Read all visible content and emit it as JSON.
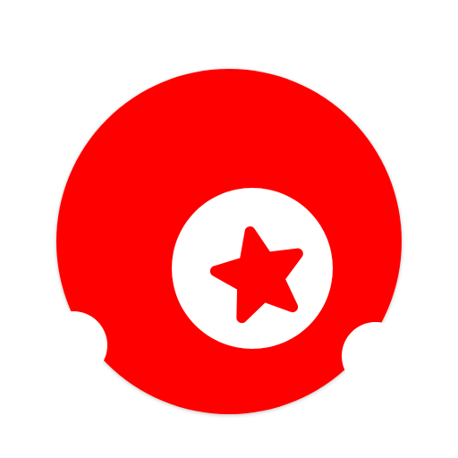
{
  "app_icon": {
    "name": "red-disc-star-logo",
    "colors": {
      "primary": "#ff0000",
      "background": "#ffffff",
      "shadow": "#e8e8e8"
    },
    "glyphs": [
      "star-icon"
    ]
  }
}
